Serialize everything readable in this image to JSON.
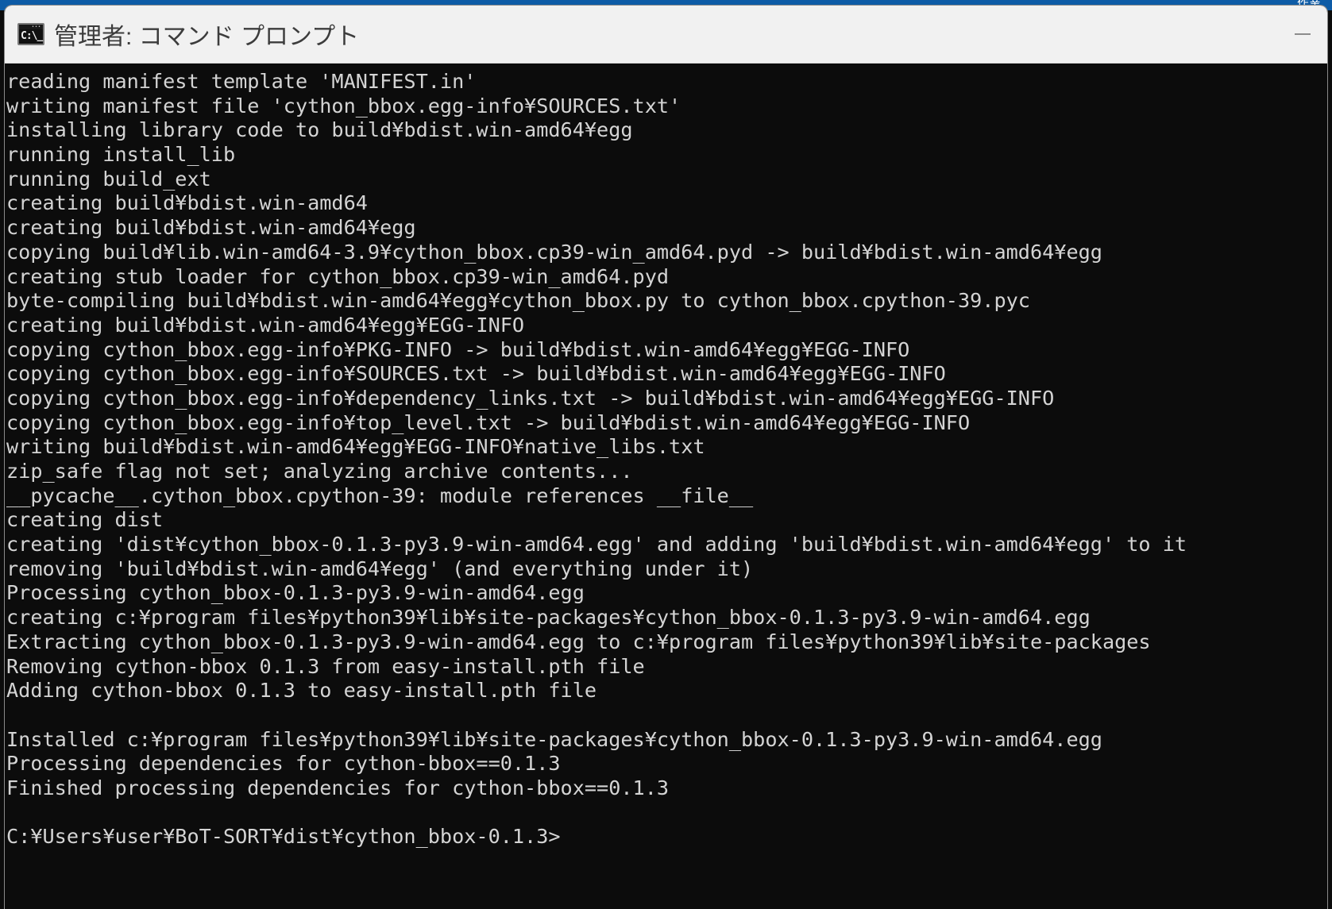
{
  "background_window": {
    "title_fragment": "作業"
  },
  "window": {
    "title": "管理者: コマンド プロンプト",
    "icon": "cmd-console-icon",
    "icon_glyph": "C:\\_",
    "controls": {
      "minimize_label": "—"
    },
    "colors": {
      "titlebar_bg": "#f1f1f1",
      "title_text": "#3c3c3c",
      "terminal_bg": "#0c0c0c",
      "terminal_fg": "#d4d4d4",
      "taskbar_blue": "#0d5ba6"
    }
  },
  "terminal": {
    "prompt": "C:¥Users¥user¥BoT-SORT¥dist¥cython_bbox-0.1.3>",
    "lines": [
      "reading manifest template 'MANIFEST.in'",
      "writing manifest file 'cython_bbox.egg-info¥SOURCES.txt'",
      "installing library code to build¥bdist.win-amd64¥egg",
      "running install_lib",
      "running build_ext",
      "creating build¥bdist.win-amd64",
      "creating build¥bdist.win-amd64¥egg",
      "copying build¥lib.win-amd64-3.9¥cython_bbox.cp39-win_amd64.pyd -> build¥bdist.win-amd64¥egg",
      "creating stub loader for cython_bbox.cp39-win_amd64.pyd",
      "byte-compiling build¥bdist.win-amd64¥egg¥cython_bbox.py to cython_bbox.cpython-39.pyc",
      "creating build¥bdist.win-amd64¥egg¥EGG-INFO",
      "copying cython_bbox.egg-info¥PKG-INFO -> build¥bdist.win-amd64¥egg¥EGG-INFO",
      "copying cython_bbox.egg-info¥SOURCES.txt -> build¥bdist.win-amd64¥egg¥EGG-INFO",
      "copying cython_bbox.egg-info¥dependency_links.txt -> build¥bdist.win-amd64¥egg¥EGG-INFO",
      "copying cython_bbox.egg-info¥top_level.txt -> build¥bdist.win-amd64¥egg¥EGG-INFO",
      "writing build¥bdist.win-amd64¥egg¥EGG-INFO¥native_libs.txt",
      "zip_safe flag not set; analyzing archive contents...",
      "__pycache__.cython_bbox.cpython-39: module references __file__",
      "creating dist",
      "creating 'dist¥cython_bbox-0.1.3-py3.9-win-amd64.egg' and adding 'build¥bdist.win-amd64¥egg' to it",
      "removing 'build¥bdist.win-amd64¥egg' (and everything under it)",
      "Processing cython_bbox-0.1.3-py3.9-win-amd64.egg",
      "creating c:¥program files¥python39¥lib¥site-packages¥cython_bbox-0.1.3-py3.9-win-amd64.egg",
      "Extracting cython_bbox-0.1.3-py3.9-win-amd64.egg to c:¥program files¥python39¥lib¥site-packages",
      "Removing cython-bbox 0.1.3 from easy-install.pth file",
      "Adding cython-bbox 0.1.3 to easy-install.pth file",
      "",
      "Installed c:¥program files¥python39¥lib¥site-packages¥cython_bbox-0.1.3-py3.9-win-amd64.egg",
      "Processing dependencies for cython-bbox==0.1.3",
      "Finished processing dependencies for cython-bbox==0.1.3",
      "",
      "C:¥Users¥user¥BoT-SORT¥dist¥cython_bbox-0.1.3>"
    ]
  }
}
